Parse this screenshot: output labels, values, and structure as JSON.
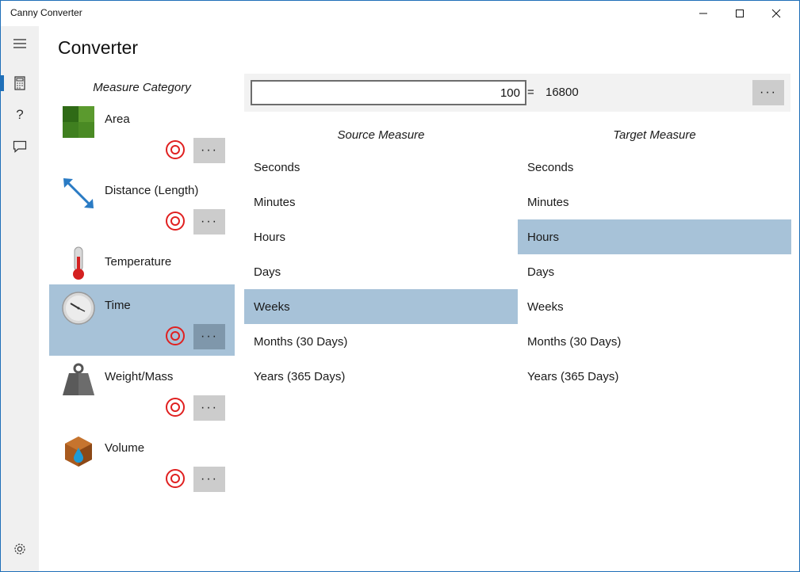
{
  "window": {
    "title": "Canny Converter"
  },
  "page": {
    "title": "Converter"
  },
  "categories": {
    "header": "Measure Category",
    "items": [
      {
        "label": "Area"
      },
      {
        "label": "Distance (Length)"
      },
      {
        "label": "Temperature"
      },
      {
        "label": "Time"
      },
      {
        "label": "Weight/Mass"
      },
      {
        "label": "Volume"
      }
    ]
  },
  "converter": {
    "input_value": "100",
    "equals": "=",
    "result": "16800",
    "more": "···"
  },
  "source": {
    "header": "Source Measure",
    "units": [
      "Seconds",
      "Minutes",
      "Hours",
      "Days",
      "Weeks",
      "Months (30 Days)",
      "Years (365 Days)"
    ],
    "selected": "Weeks"
  },
  "target": {
    "header": "Target Measure",
    "units": [
      "Seconds",
      "Minutes",
      "Hours",
      "Days",
      "Weeks",
      "Months (30 Days)",
      "Years (365 Days)"
    ],
    "selected": "Hours"
  },
  "selected_category": "Time",
  "colors": {
    "selection": "#a7c2d8",
    "accent": "#1f6fb8"
  },
  "icons": [
    "hamburger-icon",
    "calculator-icon",
    "help-icon",
    "feedback-icon",
    "settings-icon"
  ]
}
